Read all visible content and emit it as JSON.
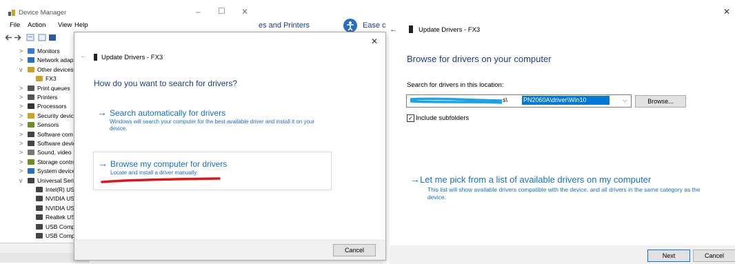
{
  "device_manager": {
    "title": "Device Manager",
    "caption_buttons": [
      "–",
      "☐",
      "✕"
    ],
    "menu": [
      "File",
      "Action",
      "View",
      "Help"
    ],
    "tree": [
      {
        "label": "Monitors",
        "chevron": ">",
        "color": "#3a7bd5",
        "indent": 1
      },
      {
        "label": "Network adap",
        "chevron": ">",
        "color": "#2b6cc4",
        "indent": 1
      },
      {
        "label": "Other devices",
        "chevron": "v",
        "color": "#c9a227",
        "indent": 1
      },
      {
        "label": "FX3",
        "chevron": "",
        "color": "#c9a227",
        "indent": 2
      },
      {
        "label": "Print queues",
        "chevron": ">",
        "color": "#555555",
        "indent": 1
      },
      {
        "label": "Printers",
        "chevron": ">",
        "color": "#555555",
        "indent": 1
      },
      {
        "label": "Processors",
        "chevron": ">",
        "color": "#333333",
        "indent": 1
      },
      {
        "label": "Security devic",
        "chevron": ">",
        "color": "#c9a227",
        "indent": 1
      },
      {
        "label": "Sensors",
        "chevron": ">",
        "color": "#6b8e23",
        "indent": 1
      },
      {
        "label": "Software com",
        "chevron": ">",
        "color": "#444444",
        "indent": 1
      },
      {
        "label": "Software devic",
        "chevron": ">",
        "color": "#444444",
        "indent": 1
      },
      {
        "label": "Sound, video",
        "chevron": ">",
        "color": "#777777",
        "indent": 1
      },
      {
        "label": "Storage contro",
        "chevron": ">",
        "color": "#6b8e23",
        "indent": 1
      },
      {
        "label": "System device",
        "chevron": ">",
        "color": "#2b6cc4",
        "indent": 1
      },
      {
        "label": "Universal Seria",
        "chevron": "v",
        "color": "#444444",
        "indent": 1
      },
      {
        "label": "Intel(R) US",
        "chevron": "",
        "color": "#444444",
        "indent": 2
      },
      {
        "label": "NVIDIA US",
        "chevron": "",
        "color": "#444444",
        "indent": 2
      },
      {
        "label": "NVIDIA US",
        "chevron": "",
        "color": "#444444",
        "indent": 2
      },
      {
        "label": "Realtek US",
        "chevron": "",
        "color": "#444444",
        "indent": 2
      },
      {
        "label": "USB Comp",
        "chevron": "",
        "color": "#444444",
        "indent": 2
      },
      {
        "label": "USB Comp",
        "chevron": "",
        "color": "#444444",
        "indent": 2
      }
    ]
  },
  "background": {
    "printers_text": "es and Printers",
    "ease_text": "Ease c"
  },
  "dialog1": {
    "close": "✕",
    "back": "←",
    "title": "Update Drivers - FX3",
    "heading": "How do you want to search for drivers?",
    "option1": {
      "title": "Search automatically for drivers",
      "description": "Windows will search your computer for the best available driver and install it on your device."
    },
    "option2": {
      "title": "Browse my computer for drivers",
      "description": "Locate and install a driver manually."
    },
    "cancel": "Cancel",
    "annotation_color": "#e0151b"
  },
  "dialog2": {
    "close": "✕",
    "back": "←",
    "title": "Update Drivers - FX3",
    "heading": "Browse for drivers on your computer",
    "location_label": "Search for drivers in this location:",
    "path_prefix": "s\\",
    "path_selected": "PN2060A\\driver\\Win10",
    "browse": "Browse...",
    "include_subfolders": "Include subfolders",
    "include_checked": "✓",
    "pick_title": "Let me pick from a list of available drivers on my computer",
    "pick_description": "This list will show available drivers compatible with the device, and all drivers in the same category as the device.",
    "next": "Next",
    "cancel": "Cancel",
    "redaction_color": "#1aa3e8"
  }
}
